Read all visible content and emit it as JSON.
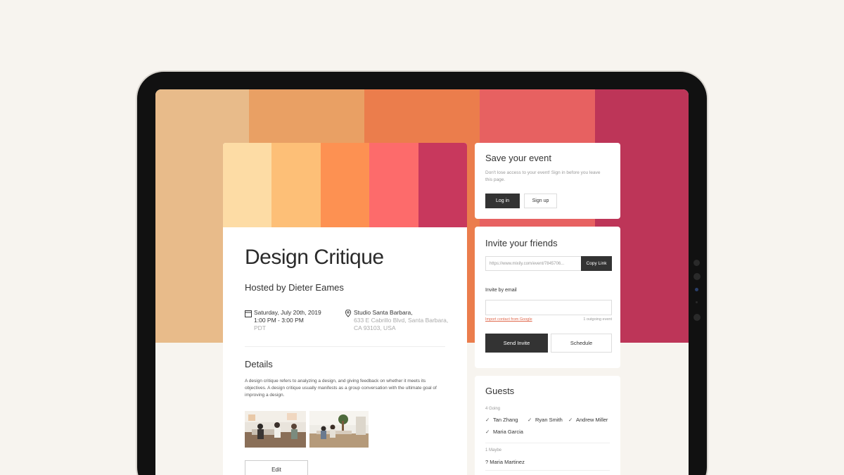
{
  "theme": {
    "background_palette": [
      "#e8bb8a",
      "#e9a064",
      "#eb7d4c",
      "#e76161",
      "#bd3558"
    ],
    "card_palette": [
      "#fddca5",
      "#fdbf77",
      "#fd9152",
      "#fd6b6b",
      "#c8385d"
    ],
    "dark_button": "#333333",
    "link_color": "#e06a4e"
  },
  "event": {
    "title": "Design Critique",
    "host": "Hosted by Dieter Eames",
    "date_line": "Saturday, July 20th, 2019",
    "time_line": "1:00 PM - 3:00 PM",
    "timezone": "PDT",
    "venue": "Studio Santa Barbara,",
    "address_line1": "633 E Cabrillo Blvd, Santa Barbara,",
    "address_line2": "CA 93103, USA",
    "details_heading": "Details",
    "description": "A design critique refers to analyzing a design, and giving feedback on whether it meets its objectives. A design critique usually manifests as a group conversation with the ultimate goal of improving a design.",
    "edit_label": "Edit"
  },
  "save_card": {
    "heading": "Save your event",
    "text": "Don't lose access to your event! Sign in before you leave this page.",
    "login_label": "Log in",
    "signup_label": "Sign up"
  },
  "invite_card": {
    "heading": "Invite your friends",
    "link_value": "https://www.mixily.com/event/7845706...",
    "copy_label": "Copy Link",
    "email_label": "Invite by email",
    "import_link": "Import contact from Google",
    "outgoing": "1 outgoing event",
    "send_label": "Send Invite",
    "schedule_label": "Schedule"
  },
  "guests": {
    "heading": "Guests",
    "going_label": "4 Going",
    "going": [
      "Tan Zhang",
      "Ryan Smith",
      "Andrew Miller",
      "Maria Garcia"
    ],
    "maybe_label": "1 Maybe",
    "maybe": [
      "? Maria Martinez"
    ]
  }
}
